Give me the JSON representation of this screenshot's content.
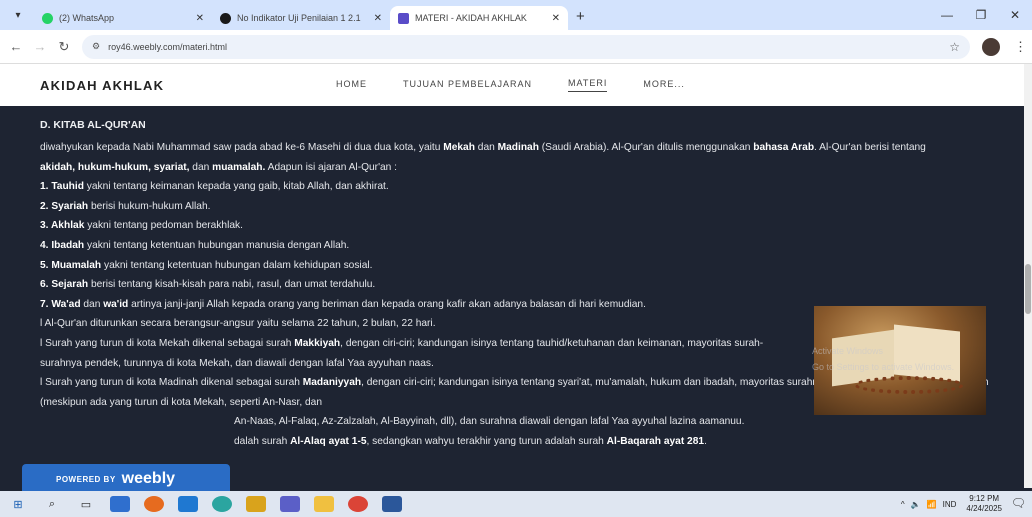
{
  "browser": {
    "tabs": [
      {
        "title": "(2) WhatsApp",
        "color": "#25d366"
      },
      {
        "title": "No Indikator Uji Penilaian 1 2.1",
        "color": "#1a1a1a"
      },
      {
        "title": "MATERI - AKIDAH AKHLAK",
        "color": "#5a4cc8"
      }
    ],
    "url": "roy46.weebly.com/materi.html"
  },
  "site": {
    "logo": "AKIDAH AKHLAK",
    "nav": [
      "HOME",
      "TUJUAN PEMBELAJARAN",
      "MATERI",
      "MORE..."
    ]
  },
  "content": {
    "heading": "D. KITAB AL-QUR'AN",
    "p1_a": "diwahyukan kepada Nabi Muhammad saw pada abad ke-6 Masehi di dua dua kota, yaitu ",
    "p1_b": "Mekah",
    "p1_c": " dan ",
    "p1_d": "Madinah",
    "p1_e": " (Saudi Arabia). Al-Qur'an ditulis menggunakan ",
    "p1_f": "bahasa Arab",
    "p1_g": ". Al-Qur'an berisi tentang ",
    "p1_h": "akidah, hukum-hukum, syariat,",
    "p1_i": " dan ",
    "p1_j": "muamalah.",
    "p1_k": " Adapun isi ajaran Al-Qur'an :",
    "items": [
      {
        "num": "1. ",
        "term": "Tauhid",
        "text": " yakni tentang keimanan kepada yang gaib, kitab Allah, dan akhirat."
      },
      {
        "num": "2. ",
        "term": "Syariah",
        "text": " berisi hukum-hukum Allah."
      },
      {
        "num": "3. ",
        "term": "Akhlak",
        "text": " yakni tentang pedoman berakhlak."
      },
      {
        "num": "4. ",
        "term": "Ibadah",
        "text": " yakni tentang ketentuan hubungan manusia dengan Allah."
      },
      {
        "num": "5. ",
        "term": "Muamalah",
        "text": " yakni tentang ketentuan hubungan dalam kehidupan sosial."
      },
      {
        "num": "6. ",
        "term": "Sejarah",
        "text": " berisi tentang kisah-kisah para nabi, rasul, dan umat terdahulu."
      }
    ],
    "item7_num": "7. ",
    "item7_term1": "Wa'ad",
    "item7_mid": " dan ",
    "item7_term2": "wa'id",
    "item7_text": " artinya janji-janji Allah kepada orang yang beriman dan kepada orang kafir akan adanya balasan di hari kemudian.",
    "line_22": "l Al-Qur'an diturunkan secara berangsur-angsur yaitu selama 22 tahun, 2 bulan, 22 hari.",
    "mekah_a": "l Surah yang turun di kota Mekah dikenal sebagai surah ",
    "mekah_b": "Makkiyah",
    "mekah_c": ", dengan ciri-ciri; kandungan isinya tentang tauhid/ketuhanan dan keimanan, mayoritas surah-surahnya pendek, turunnya di kota Mekah, dan diawali dengan lafal Yaa ayyuhan naas.",
    "madinah_a": "l Surah yang turun di kota Madinah dikenal sebagai surah ",
    "madinah_b": "Madaniyyah",
    "madinah_c": ", dengan ciri-ciri; kandungan isinya tentang syari'at, mu'amalah, hukum dan ibadah, mayoritas surahnya panjang dan turun di kota Madinah (meskipun ada yang turun di kota Mekah, seperti An-Nasr, dan",
    "line_last1": "An-Naas, Al-Falaq, Az-Zalzalah, Al-Bayyinah, dll), dan surahna diawali dengan lafal Yaa ayyuhal lazina aamanuu.",
    "line_last2_a": "dalah surah ",
    "line_last2_b": "Al-Alaq ayat 1-5",
    "line_last2_c": ", sedangkan wahyu terakhir yang turun adalah surah ",
    "line_last2_d": "Al-Baqarah ayat 281",
    "line_last2_e": "."
  },
  "watermark": {
    "line1": "Activate Windows",
    "line2": "Go to Settings to activate Windows."
  },
  "badge": {
    "small": "POWERED BY",
    "big": "weebly"
  },
  "taskbar": {
    "lang": "IND",
    "time": "9:12 PM",
    "date": "4/24/2025"
  }
}
